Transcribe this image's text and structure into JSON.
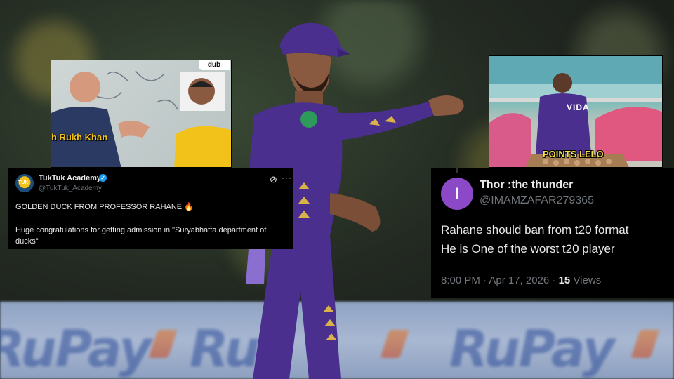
{
  "meme_left": {
    "caption": "h Rukh Khan",
    "corner_label": "dub"
  },
  "meme_right": {
    "jersey_text": "VIDA",
    "caption": "POINTS LELO"
  },
  "tweet_left": {
    "display_name": "TukTuk Academy",
    "handle": "@TukTuk_Academy",
    "line1": "GOLDEN DUCK FROM PROFESSOR RAHANE 🔥",
    "line2": "Huge congratulations for getting admission in \"Suryabhatta department of ducks\""
  },
  "tweet_right": {
    "avatar_letter": "I",
    "display_name": "Thor :the thunder",
    "handle": "@IMAMZAFAR279365",
    "line1": "Rahane should ban from t20 format",
    "line2": "He is One of the worst t20 player",
    "time": "8:00 PM · Apr 17, 2026 · ",
    "views_count": "15",
    "views_label": " Views"
  },
  "background": {
    "ad_word_left": "RuPay",
    "ad_word_mid": "Ru",
    "ad_word_right": "RuPay"
  },
  "colors": {
    "kkr_purple": "#4a2f8f",
    "kkr_gold": "#d9b24a",
    "tweet_bg": "#000000",
    "muted_text": "#71767b",
    "verified_blue": "#1d9bf0"
  }
}
